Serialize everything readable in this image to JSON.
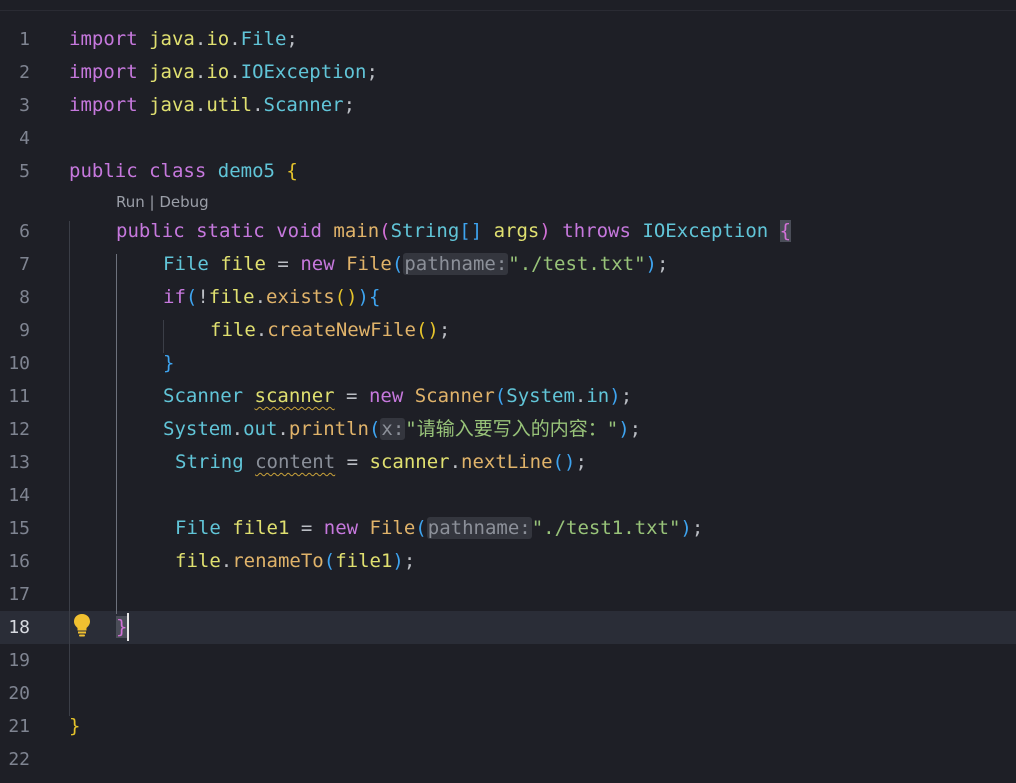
{
  "editor": {
    "codelens": "Run | Debug",
    "lines": [
      {
        "n": "1",
        "parts": [
          [
            "kw",
            "import"
          ],
          [
            "pn",
            " "
          ],
          [
            "pkg",
            "java"
          ],
          [
            "pn",
            "."
          ],
          [
            "pkg",
            "io"
          ],
          [
            "pn",
            "."
          ],
          [
            "ty",
            "File"
          ],
          [
            "pn",
            ";"
          ]
        ]
      },
      {
        "n": "2",
        "parts": [
          [
            "kw",
            "import"
          ],
          [
            "pn",
            " "
          ],
          [
            "pkg",
            "java"
          ],
          [
            "pn",
            "."
          ],
          [
            "pkg",
            "io"
          ],
          [
            "pn",
            "."
          ],
          [
            "ty",
            "IOException"
          ],
          [
            "pn",
            ";"
          ]
        ]
      },
      {
        "n": "3",
        "parts": [
          [
            "kw",
            "import"
          ],
          [
            "pn",
            " "
          ],
          [
            "pkg",
            "java"
          ],
          [
            "pn",
            "."
          ],
          [
            "pkg",
            "util"
          ],
          [
            "pn",
            "."
          ],
          [
            "ty",
            "Scanner"
          ],
          [
            "pn",
            ";"
          ]
        ]
      },
      {
        "n": "4",
        "parts": []
      },
      {
        "n": "5",
        "parts": [
          [
            "kw",
            "public"
          ],
          [
            "pn",
            " "
          ],
          [
            "kw",
            "class"
          ],
          [
            "pn",
            " "
          ],
          [
            "ty",
            "demo5"
          ],
          [
            "pn",
            " "
          ],
          [
            "p1",
            "{"
          ]
        ]
      },
      {
        "n": "6",
        "parts": [
          [
            "kw",
            "public"
          ],
          [
            "pn",
            " "
          ],
          [
            "kw",
            "static"
          ],
          [
            "pn",
            " "
          ],
          [
            "kw",
            "void"
          ],
          [
            "pn",
            " "
          ],
          [
            "fn",
            "main"
          ],
          [
            "p2",
            "("
          ],
          [
            "ty",
            "String"
          ],
          [
            "p3",
            "[]"
          ],
          [
            "pn",
            " "
          ],
          [
            "var",
            "args"
          ],
          [
            "p2",
            ")"
          ],
          [
            "pn",
            " "
          ],
          [
            "kw",
            "throws"
          ],
          [
            "pn",
            " "
          ],
          [
            "ty",
            "IOException"
          ],
          [
            "pn",
            " "
          ],
          [
            "p2 bracket-match",
            "{"
          ]
        ]
      },
      {
        "n": "7",
        "parts": [
          [
            "ty",
            "File"
          ],
          [
            "pn",
            " "
          ],
          [
            "var",
            "file"
          ],
          [
            "pn",
            " = "
          ],
          [
            "kw",
            "new"
          ],
          [
            "pn",
            " "
          ],
          [
            "fn",
            "File"
          ],
          [
            "p3",
            "("
          ],
          [
            "hint",
            "pathname:"
          ],
          [
            "str",
            "\"./test.txt\""
          ],
          [
            "p3",
            ")"
          ],
          [
            "pn",
            ";"
          ]
        ]
      },
      {
        "n": "8",
        "parts": [
          [
            "kw",
            "if"
          ],
          [
            "p3",
            "("
          ],
          [
            "pn",
            "!"
          ],
          [
            "var",
            "file"
          ],
          [
            "pn",
            "."
          ],
          [
            "fn",
            "exists"
          ],
          [
            "p1",
            "()"
          ],
          [
            "p3",
            ")"
          ],
          [
            "p3",
            "{"
          ]
        ]
      },
      {
        "n": "9",
        "parts": [
          [
            "var",
            "file"
          ],
          [
            "pn",
            "."
          ],
          [
            "fn",
            "createNewFile"
          ],
          [
            "p1",
            "()"
          ],
          [
            "pn",
            ";"
          ]
        ]
      },
      {
        "n": "10",
        "parts": [
          [
            "p3",
            "}"
          ]
        ]
      },
      {
        "n": "11",
        "parts": [
          [
            "ty",
            "Scanner"
          ],
          [
            "pn",
            " "
          ],
          [
            "var squig",
            "scanner"
          ],
          [
            "pn",
            " = "
          ],
          [
            "kw",
            "new"
          ],
          [
            "pn",
            " "
          ],
          [
            "fn",
            "Scanner"
          ],
          [
            "p3",
            "("
          ],
          [
            "ty",
            "System"
          ],
          [
            "pn",
            "."
          ],
          [
            "ty",
            "in"
          ],
          [
            "p3",
            ")"
          ],
          [
            "pn",
            ";"
          ]
        ]
      },
      {
        "n": "12",
        "parts": [
          [
            "ty",
            "System"
          ],
          [
            "pn",
            "."
          ],
          [
            "ty",
            "out"
          ],
          [
            "pn",
            "."
          ],
          [
            "fn",
            "println"
          ],
          [
            "p3",
            "("
          ],
          [
            "hint",
            "x:"
          ],
          [
            "str",
            "\"请输入要写入的内容：\""
          ],
          [
            "p3",
            ")"
          ],
          [
            "pn",
            ";"
          ]
        ]
      },
      {
        "n": "13",
        "parts": [
          [
            "ty",
            "String"
          ],
          [
            "pn",
            " "
          ],
          [
            "dim squig",
            "content"
          ],
          [
            "pn",
            " = "
          ],
          [
            "var",
            "scanner"
          ],
          [
            "pn",
            "."
          ],
          [
            "fn",
            "nextLine"
          ],
          [
            "p3",
            "()"
          ],
          [
            "pn",
            ";"
          ]
        ]
      },
      {
        "n": "14",
        "parts": []
      },
      {
        "n": "15",
        "parts": [
          [
            "ty",
            "File"
          ],
          [
            "pn",
            " "
          ],
          [
            "var",
            "file1"
          ],
          [
            "pn",
            " = "
          ],
          [
            "kw",
            "new"
          ],
          [
            "pn",
            " "
          ],
          [
            "fn",
            "File"
          ],
          [
            "p3",
            "("
          ],
          [
            "hint",
            "pathname:"
          ],
          [
            "str",
            "\"./test1.txt\""
          ],
          [
            "p3",
            ")"
          ],
          [
            "pn",
            ";"
          ]
        ]
      },
      {
        "n": "16",
        "parts": [
          [
            "var",
            "file"
          ],
          [
            "pn",
            "."
          ],
          [
            "fn",
            "renameTo"
          ],
          [
            "p3",
            "("
          ],
          [
            "var",
            "file1"
          ],
          [
            "p3",
            ")"
          ],
          [
            "pn",
            ";"
          ]
        ]
      },
      {
        "n": "17",
        "parts": []
      },
      {
        "n": "18",
        "parts": [
          [
            "p2 bracket-match",
            "}"
          ]
        ]
      },
      {
        "n": "19",
        "parts": []
      },
      {
        "n": "20",
        "parts": []
      },
      {
        "n": "21",
        "parts": [
          [
            "p1",
            "}"
          ]
        ]
      },
      {
        "n": "22",
        "parts": []
      }
    ],
    "active_line": "18",
    "lightbulb_icon": "lightbulb-icon"
  }
}
